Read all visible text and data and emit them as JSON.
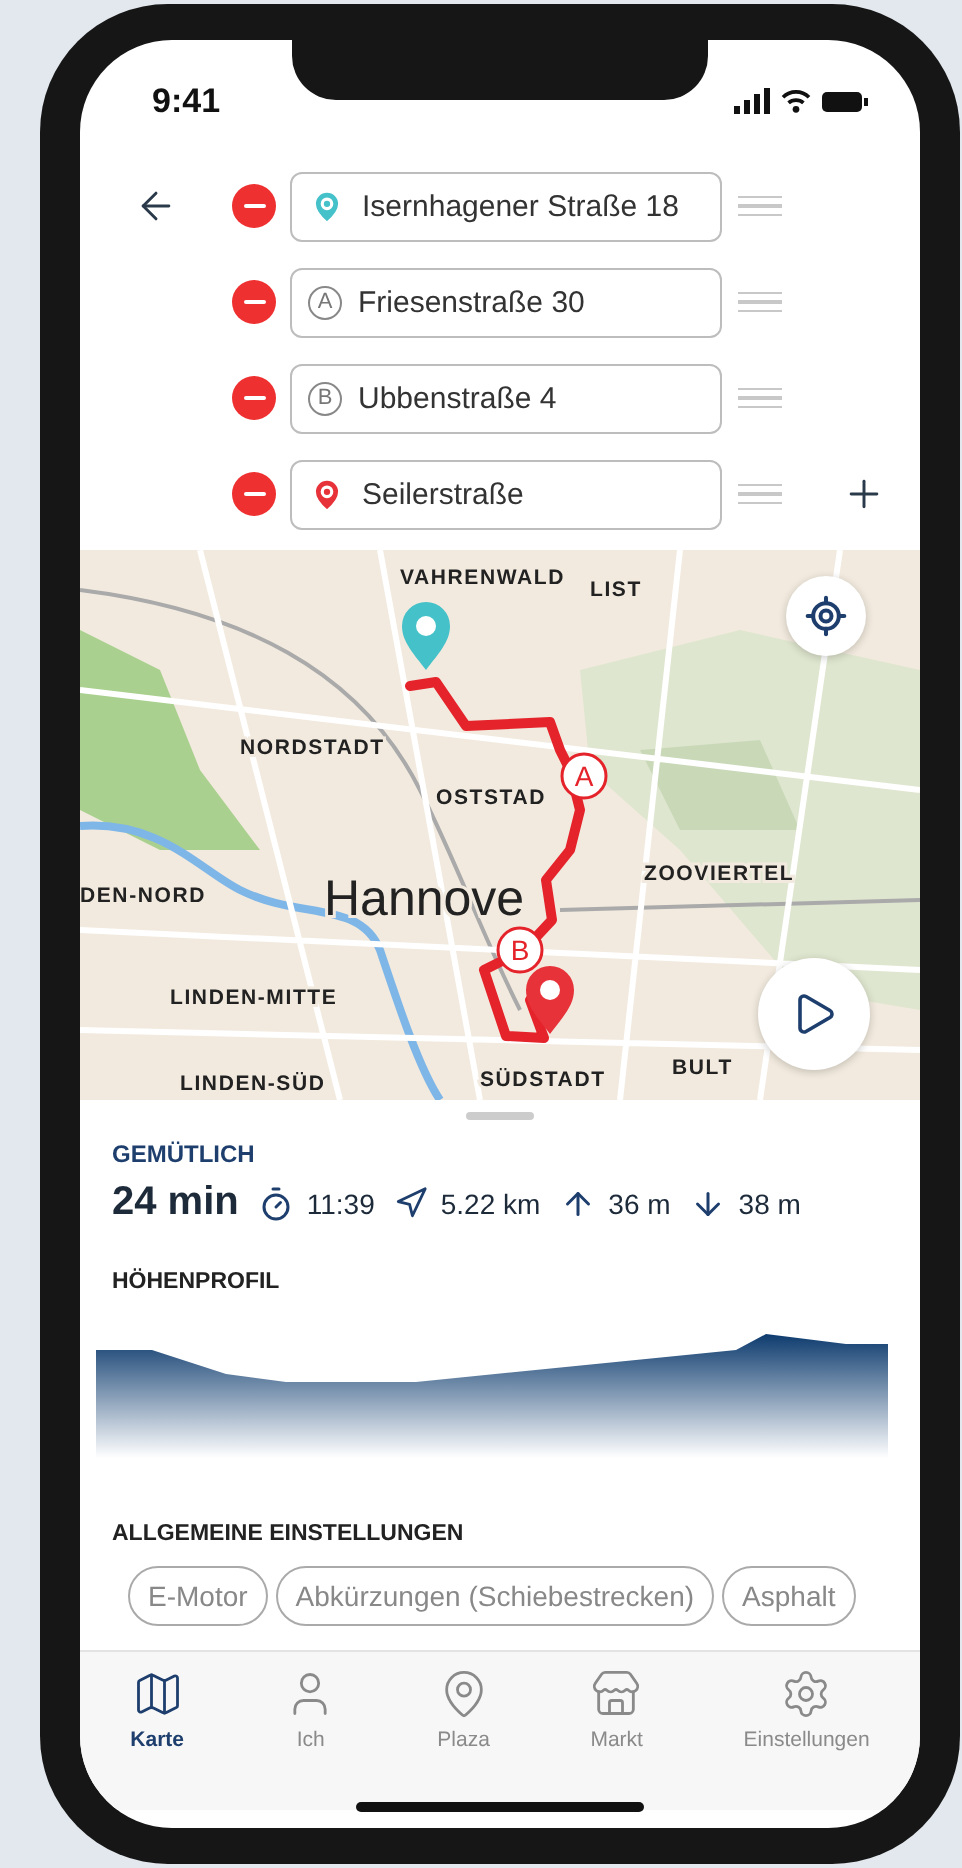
{
  "status_bar": {
    "time": "9:41"
  },
  "waypoints": [
    {
      "kind": "start",
      "text": "Isernhagener Straße 18",
      "color": "#45c1c9"
    },
    {
      "kind": "via",
      "marker": "A",
      "text": "Friesenstraße 30"
    },
    {
      "kind": "via",
      "marker": "B",
      "text": "Ubbenstraße 4"
    },
    {
      "kind": "end",
      "text": "Seilerstraße",
      "color": "#e8323a"
    }
  ],
  "map": {
    "labels": [
      {
        "kind": "district",
        "text": "VAHRENWALD"
      },
      {
        "kind": "district",
        "text": "LIST"
      },
      {
        "kind": "district",
        "text": "NORDSTADT"
      },
      {
        "kind": "district",
        "text": "OSTSTAD"
      },
      {
        "kind": "district",
        "text": "ZOOVIERTEL"
      },
      {
        "kind": "district",
        "text": "DEN-NORD"
      },
      {
        "kind": "city",
        "text": "Hannove"
      },
      {
        "kind": "district",
        "text": "LINDEN-MITTE"
      },
      {
        "kind": "district",
        "text": "BULT"
      },
      {
        "kind": "district",
        "text": "LINDEN-SÜD"
      },
      {
        "kind": "district",
        "text": "SÜDSTADT"
      }
    ],
    "route_markers": [
      "A",
      "B"
    ]
  },
  "summary": {
    "profile": "GEMÜTLICH",
    "duration": "24 min",
    "arrival": "11:39",
    "distance": "5.22 km",
    "ascent": "36 m",
    "descent": "38 m"
  },
  "elevation": {
    "title": "HÖHENPROFIL"
  },
  "settings": {
    "title": "ALLGEMEINE EINSTELLUNGEN",
    "chips": [
      "E-Motor",
      "Abkürzungen (Schiebestrecken)",
      "Asphalt"
    ]
  },
  "tab_bar": [
    {
      "kind": "map",
      "label": "Karte",
      "selected": true
    },
    {
      "kind": "person",
      "label": "Ich",
      "selected": false
    },
    {
      "kind": "plaza",
      "label": "Plaza",
      "selected": false
    },
    {
      "kind": "market",
      "label": "Markt",
      "selected": false
    },
    {
      "kind": "settings",
      "label": "Einstellungen",
      "selected": false
    }
  ]
}
